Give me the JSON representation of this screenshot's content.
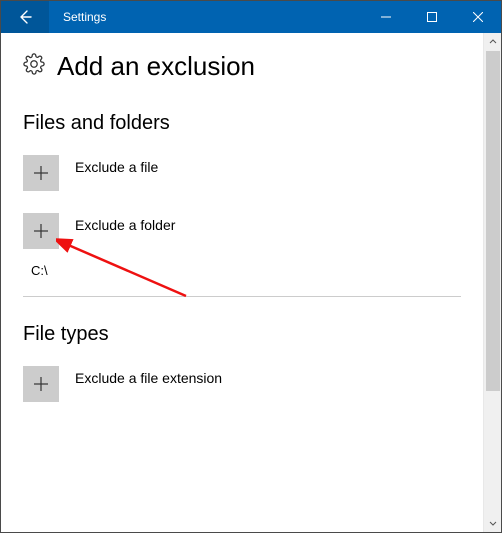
{
  "titlebar": {
    "title": "Settings"
  },
  "page": {
    "title": "Add an exclusion"
  },
  "sections": {
    "files_folders": {
      "header": "Files and folders",
      "add_file_label": "Exclude a file",
      "add_folder_label": "Exclude a folder",
      "existing_item": "C:\\"
    },
    "file_types": {
      "header": "File types",
      "add_ext_label": "Exclude a file extension"
    }
  }
}
